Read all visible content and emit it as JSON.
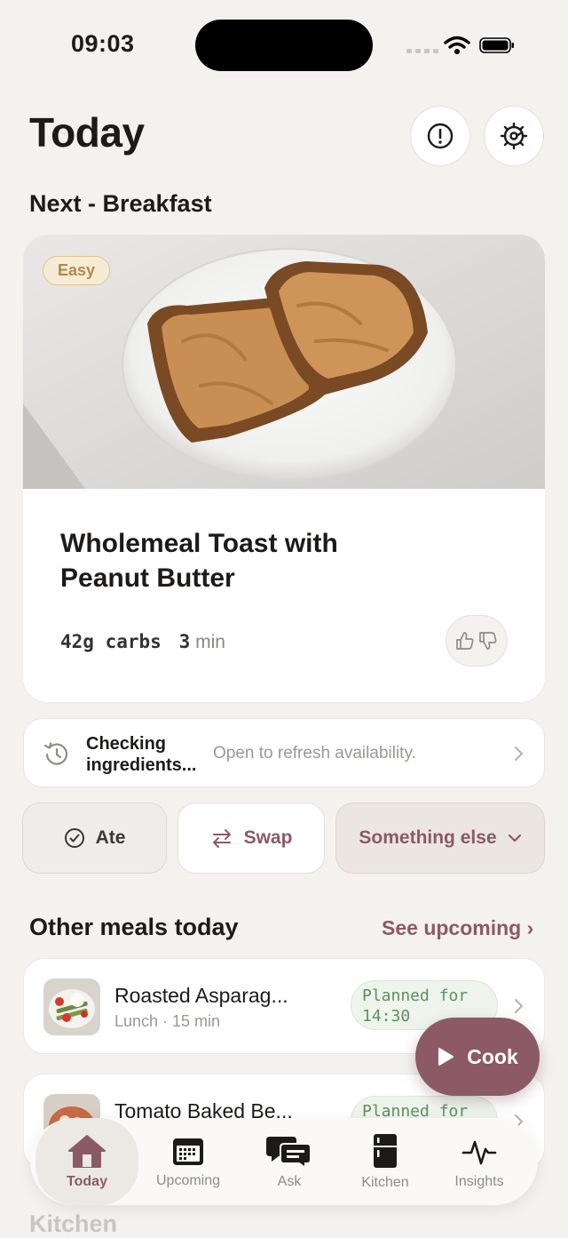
{
  "status_bar": {
    "time": "09:03"
  },
  "header": {
    "title": "Today",
    "alert_icon": "alert-circle-icon",
    "settings_icon": "gear-icon"
  },
  "next": {
    "heading": "Next - Breakfast",
    "badge": "Easy",
    "title": "Wholemeal Toast with Peanut Butter",
    "carbs": "42g carbs",
    "time_value": "3",
    "time_unit": "min"
  },
  "ingredients": {
    "title": "Checking ingredients...",
    "subtitle": "Open to refresh availability."
  },
  "actions": {
    "ate": "Ate",
    "swap": "Swap",
    "something_else": "Something else"
  },
  "other_meals": {
    "heading": "Other meals today",
    "see_upcoming": "See upcoming ›",
    "items": [
      {
        "title": "Roasted Asparag...",
        "subtitle": "Lunch · 15 min",
        "status_line1": "Planned for",
        "status_line2": "14:30"
      },
      {
        "title": "Tomato Baked Be...",
        "subtitle": "",
        "status_line1": "Planned for",
        "status_line2": ""
      }
    ]
  },
  "cook_button": {
    "label": "Cook"
  },
  "tabbar": {
    "tabs": [
      {
        "label": "Today",
        "icon": "home-icon",
        "active": true
      },
      {
        "label": "Upcoming",
        "icon": "calendar-icon",
        "active": false
      },
      {
        "label": "Ask",
        "icon": "chat-icon",
        "active": false
      },
      {
        "label": "Kitchen",
        "icon": "fridge-icon",
        "active": false
      },
      {
        "label": "Insights",
        "icon": "pulse-icon",
        "active": false
      }
    ]
  },
  "kitchen_peek": "Kitchen",
  "colors": {
    "accent": "#8b5a66",
    "planned_green": "#5f8f62",
    "badge_gold": "#b08a4a",
    "background": "#f4f2ee"
  }
}
